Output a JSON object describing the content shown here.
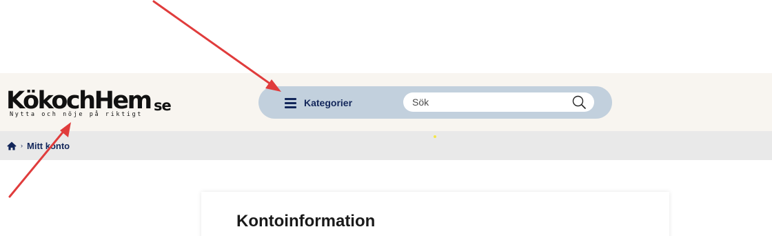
{
  "header": {
    "logo": {
      "name": "KökochHem",
      "tld": "se",
      "tagline": "Nytta och nöje på riktigt"
    },
    "menu_label": "Kategorier",
    "search": {
      "placeholder": "Sök",
      "value": ""
    }
  },
  "breadcrumb": {
    "separator": "›",
    "current": "Mitt konto"
  },
  "main": {
    "title": "Kontoinformation"
  },
  "colors": {
    "header_bg": "#f8f5f0",
    "nav_pill": "#c2d0dd",
    "nav_text": "#12265a",
    "breadcrumb_bg": "#e9e9e9",
    "annotation_arrow": "#e03c3c"
  },
  "icons": [
    "hamburger-icon",
    "search-icon",
    "home-icon"
  ]
}
